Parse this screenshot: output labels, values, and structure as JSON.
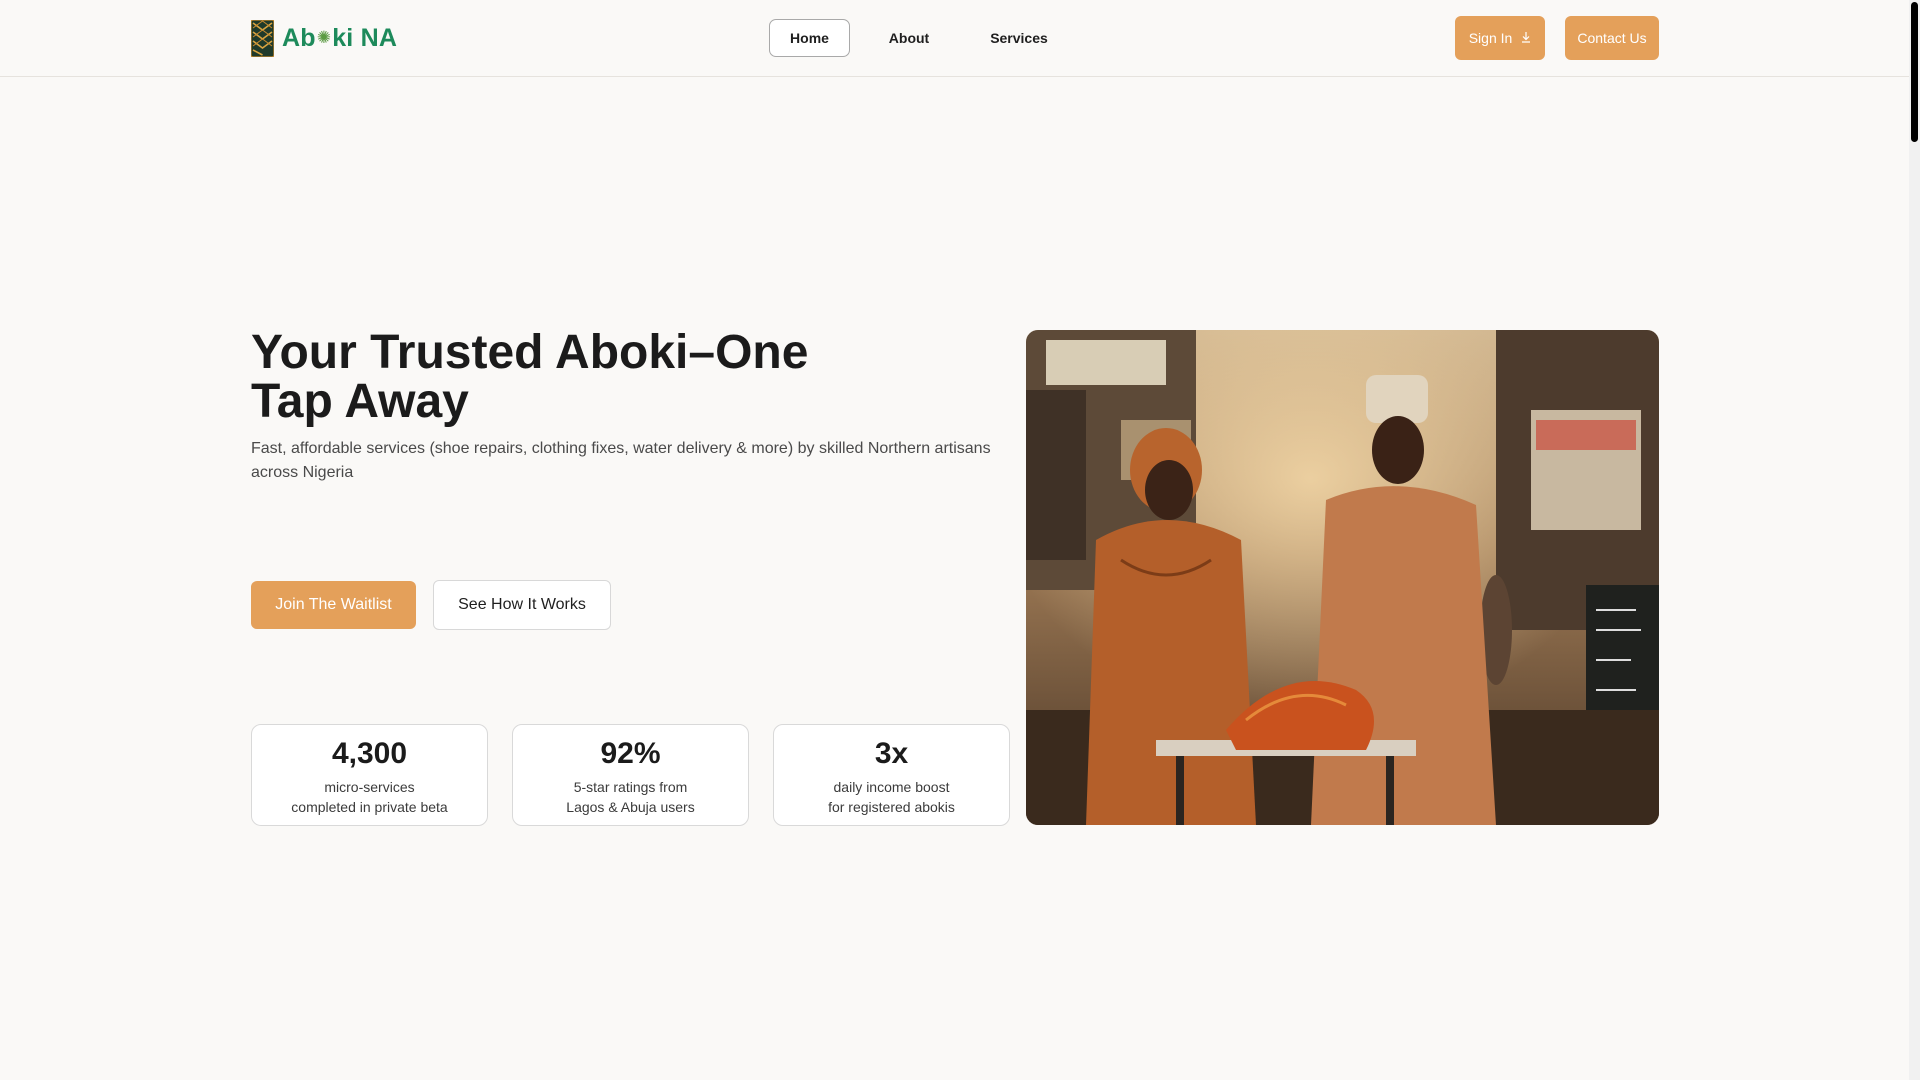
{
  "brand": {
    "logo_text_a": "Ab",
    "logo_text_b": "ki NA",
    "accent": "#e4a05a",
    "green": "#1d8a5b"
  },
  "nav": {
    "home": "Home",
    "about": "About",
    "services": "Services"
  },
  "header_actions": {
    "sign_in": "Sign In",
    "sign_in_icon": "download-icon",
    "contact": "Contact Us"
  },
  "hero": {
    "title_line1": "Your Trusted Aboki–One",
    "title_line2": "Tap Away",
    "subtitle": "Fast, affordable services (shoe repairs, clothing fixes, water delivery & more) by skilled Northern artisans across Nigeria",
    "cta_primary": "Join The Waitlist",
    "cta_secondary": "See How It Works"
  },
  "stats": [
    {
      "value": "4,300",
      "line1": "micro-services",
      "line2": "completed in private beta"
    },
    {
      "value": "92%",
      "line1": "5-star ratings from",
      "line2": "Lagos & Abuja users"
    },
    {
      "value": "3x",
      "line1": "daily income boost",
      "line2": "for registered abokis"
    }
  ],
  "hero_image": {
    "subject": "tailor-and-customer-market-photo"
  }
}
